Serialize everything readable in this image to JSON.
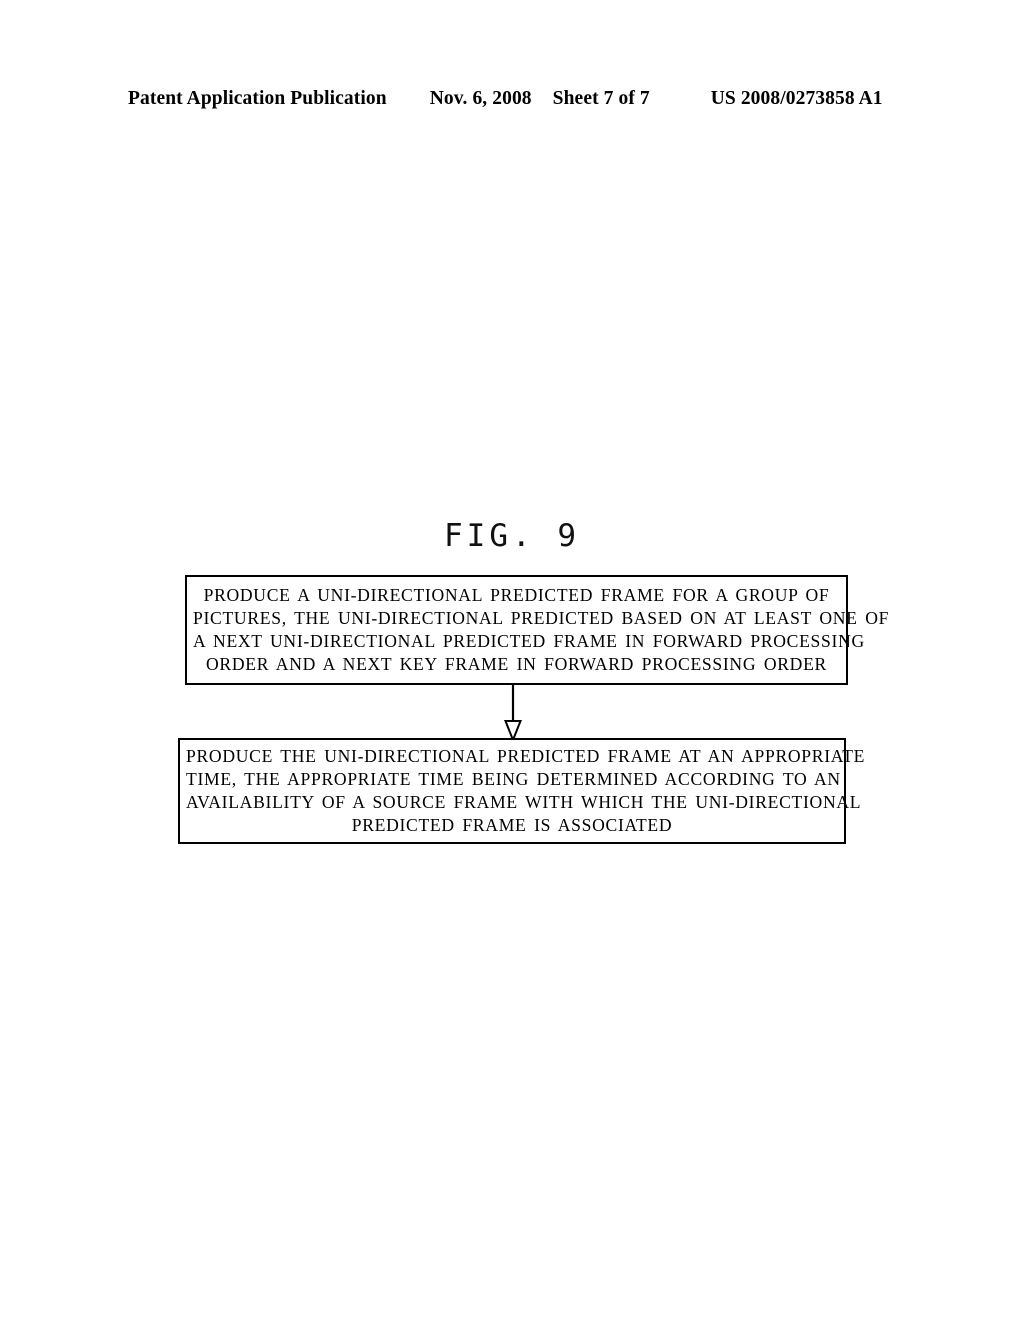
{
  "header": {
    "publication": "Patent Application Publication",
    "date": "Nov. 6, 2008",
    "sheet": "Sheet 7 of 7",
    "patent_number": "US 2008/0273858 A1"
  },
  "figure": {
    "label": "FIG. 9",
    "boxes": [
      {
        "id": "step-1",
        "lines": [
          "PRODUCE A UNI-DIRECTIONAL PREDICTED FRAME FOR A GROUP OF",
          "PICTURES, THE UNI-DIRECTIONAL PREDICTED BASED ON AT LEAST ONE OF",
          "A NEXT UNI-DIRECTIONAL PREDICTED FRAME IN FORWARD PROCESSING",
          "ORDER AND A NEXT KEY FRAME IN FORWARD PROCESSING ORDER"
        ]
      },
      {
        "id": "step-2",
        "lines": [
          "PRODUCE THE UNI-DIRECTIONAL PREDICTED FRAME AT AN APPROPRIATE",
          "TIME, THE APPROPRIATE TIME BEING DETERMINED ACCORDING TO AN",
          "AVAILABILITY OF A SOURCE FRAME WITH WHICH THE UNI-DIRECTIONAL",
          "PREDICTED FRAME IS ASSOCIATED"
        ]
      }
    ],
    "connector": {
      "type": "arrow-down",
      "from": "step-1",
      "to": "step-2"
    }
  },
  "colors": {
    "ink": "#000000",
    "paper": "#ffffff"
  }
}
